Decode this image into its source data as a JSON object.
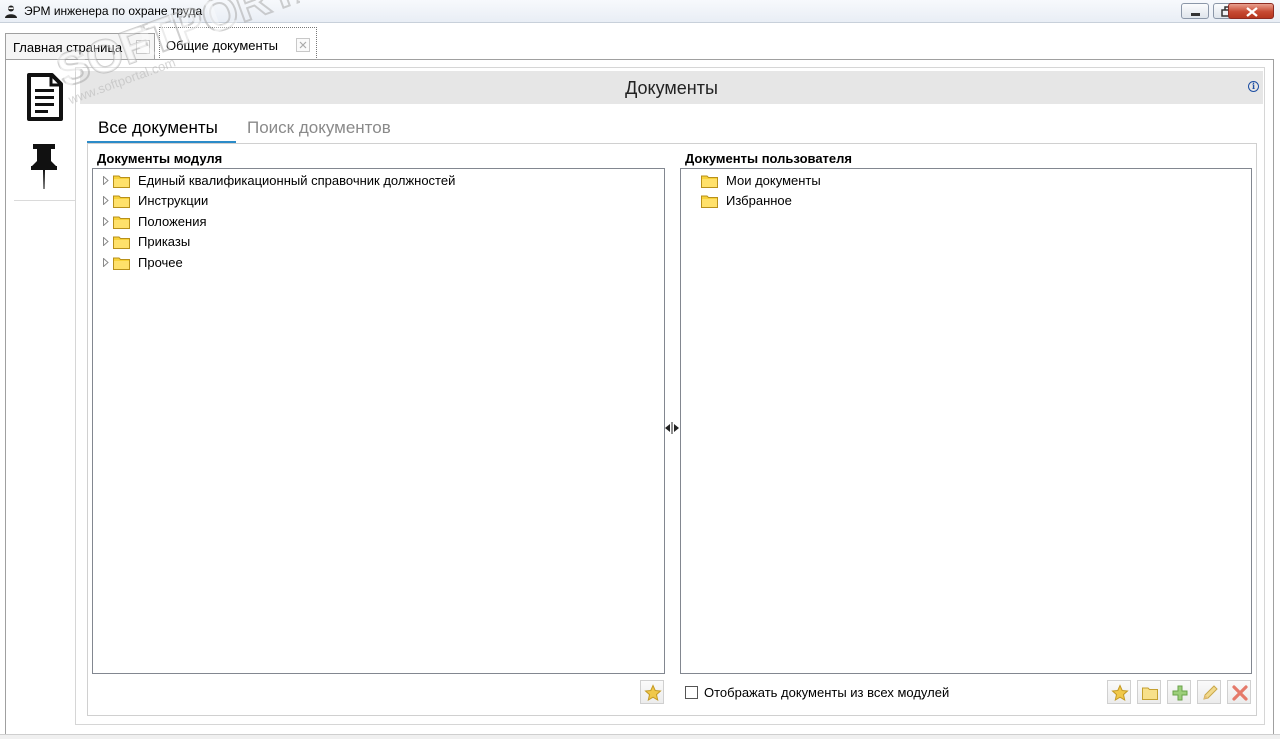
{
  "window": {
    "title": "ЭРМ инженера по охране труда",
    "icon": "user-avatar-icon",
    "controls": [
      "minimize-icon",
      "restore-icon",
      "close-icon"
    ]
  },
  "doc_tabs": [
    {
      "label": "Главная страница",
      "active": false
    },
    {
      "label": "Общие документы",
      "active": true
    }
  ],
  "sidebar": {
    "items": [
      {
        "icon": "document-icon",
        "active": true
      },
      {
        "icon": "pin-icon",
        "active": false
      }
    ]
  },
  "header": {
    "title": "Документы",
    "info_icon": "info-icon"
  },
  "inner_tabs": [
    {
      "label": "Все документы",
      "active": true
    },
    {
      "label": "Поиск документов",
      "active": false
    }
  ],
  "module_docs": {
    "title": "Документы модуля",
    "items": [
      {
        "label": "Единый квалификационный справочник должностей",
        "expandable": true
      },
      {
        "label": "Инструкции",
        "expandable": true
      },
      {
        "label": "Положения",
        "expandable": true
      },
      {
        "label": "Приказы",
        "expandable": true
      },
      {
        "label": "Прочее",
        "expandable": true
      }
    ]
  },
  "user_docs": {
    "title": "Документы пользователя",
    "items": [
      {
        "label": "Мои документы"
      },
      {
        "label": "Избранное"
      }
    ]
  },
  "options": {
    "show_all_modules_label": "Отображать документы из всех модулей",
    "show_all_modules_checked": false
  },
  "toolbar_icons": [
    "star-icon",
    "folder-icon",
    "add-icon",
    "edit-icon",
    "delete-icon"
  ],
  "watermark": {
    "main": "PORTAL",
    "sub": "www.softportal.com"
  },
  "colors": {
    "accent": "#2b8bc8",
    "header_bg": "#e6e6e6",
    "folder": "#f5c518"
  }
}
